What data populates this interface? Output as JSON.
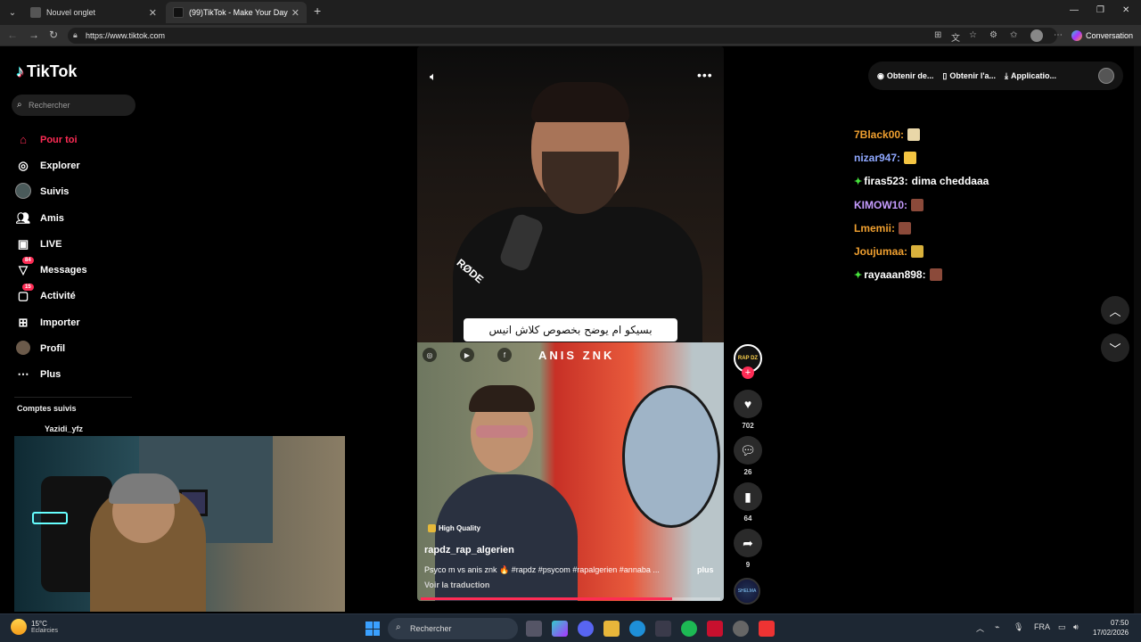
{
  "browser": {
    "tabs": [
      {
        "label": "Nouvel onglet"
      },
      {
        "label": "(99)TikTok - Make Your Day"
      }
    ],
    "url": "https://www.tiktok.com",
    "copilot_label": "Conversation"
  },
  "tiktok": {
    "logo_text": "TikTok",
    "search_placeholder": "Rechercher",
    "nav": [
      {
        "label": "Pour toi",
        "icon": "home-icon"
      },
      {
        "label": "Explorer",
        "icon": "compass-icon"
      },
      {
        "label": "Suivis",
        "icon": "following-avatar-icon"
      },
      {
        "label": "Amis",
        "icon": "friends-icon"
      },
      {
        "label": "LIVE",
        "icon": "live-icon"
      },
      {
        "label": "Messages",
        "icon": "messages-icon",
        "badge": "84"
      },
      {
        "label": "Activité",
        "icon": "activity-icon",
        "badge": "15"
      },
      {
        "label": "Importer",
        "icon": "upload-icon"
      },
      {
        "label": "Profil",
        "icon": "profile-avatar-icon"
      },
      {
        "label": "Plus",
        "icon": "more-icon"
      }
    ],
    "followed_title": "Comptes suivis",
    "followed_users": [
      "Yazidi_yfz"
    ],
    "header_links": [
      "Obtenir de...",
      "Obtenir l'a...",
      "Applicatio..."
    ],
    "video": {
      "subtitle": "بسيكو ام يوضح بخصوص كلاش انيس",
      "channel_brand": "ANIS ZNK",
      "quality_label": "High Quality",
      "author": "rapdz_rap_algerien",
      "description": "Psyco m vs anis znk 🔥 #rapdz #psycom #rapalgerien #annaba ...",
      "more_label": "plus",
      "translate_label": "Voir la traduction",
      "progress": 0.84
    },
    "creator_avatar_text": "RAP DZ",
    "music_disc_text": "SHELMA",
    "actions": {
      "likes": "702",
      "comments": "26",
      "saves": "64",
      "shares": "9"
    }
  },
  "chat": [
    {
      "user": "7Black00:",
      "color": "#f0a030",
      "message": "",
      "emote_color": "#e9d7a8",
      "gem": false
    },
    {
      "user": "nizar947:",
      "color": "#8fa8ff",
      "message": "",
      "emote_color": "#f4c542",
      "gem": false
    },
    {
      "user": "firas523:",
      "color": "#ffffff",
      "message": "dima cheddaaa",
      "emote_color": "",
      "gem": true
    },
    {
      "user": "KIMOW10:",
      "color": "#c69cff",
      "message": "",
      "emote_color": "#8b4a3a",
      "gem": false
    },
    {
      "user": "Lmemii:",
      "color": "#f0a030",
      "message": "",
      "emote_color": "#8b4a3a",
      "gem": false
    },
    {
      "user": "Joujumaa:",
      "color": "#f0a030",
      "message": "",
      "emote_color": "#d9b13c",
      "gem": false
    },
    {
      "user": "rayaaan898:",
      "color": "#ffffff",
      "message": "",
      "emote_color": "#8b4a3a",
      "gem": true
    }
  ],
  "taskbar": {
    "weather_temp": "15°C",
    "weather_desc": "Eclaircies",
    "search_label": "Rechercher",
    "language": "FRA",
    "time": "07:50",
    "date": "17/02/2026"
  }
}
